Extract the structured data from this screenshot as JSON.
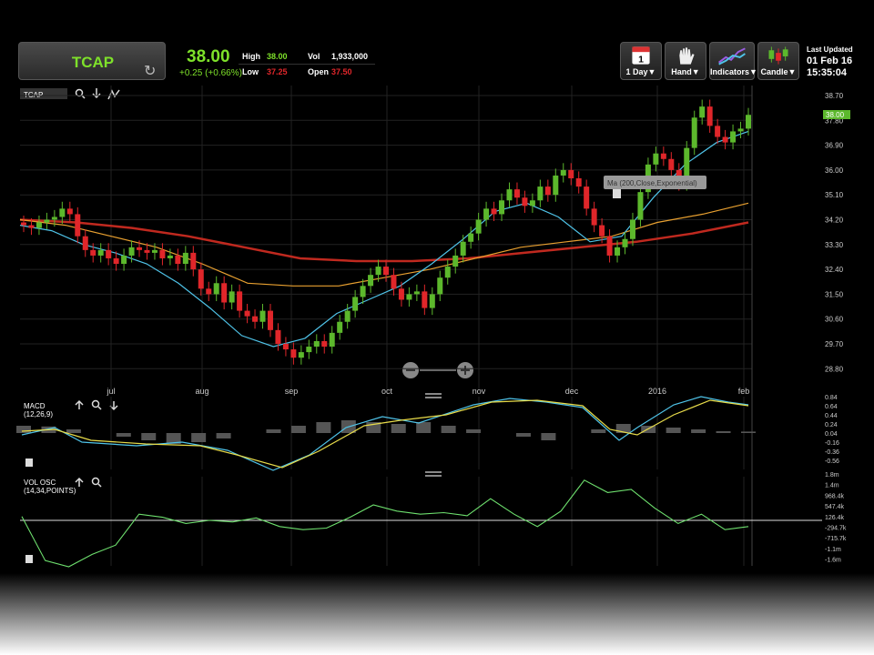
{
  "symbol": "TCAP",
  "quote": {
    "price": "38.00",
    "change": "+0.25 (+0.66%)",
    "high_label": "High",
    "high": "38.00",
    "low_label": "Low",
    "low": "37.25",
    "vol_label": "Vol",
    "vol": "1,933,000",
    "open_label": "Open",
    "open": "37.50"
  },
  "toolbar": {
    "period": "1 Day▼",
    "period_icon_text": "1",
    "hand": "Hand▼",
    "indicators": "Indicators▼",
    "candle": "Candle▼"
  },
  "updated": {
    "label": "Last Updated",
    "date": "01 Feb 16",
    "time": "15:35:04"
  },
  "colors": {
    "up": "#5cb82c",
    "down": "#e0262a",
    "accent": "#7ee12a",
    "grid": "#222222",
    "ma_fast": "#4fc3e8",
    "ma_slow": "#e8a030",
    "ma_long": "#c0291f",
    "signal": "#e8dc4a",
    "osc": "#6ee06e"
  },
  "price_chart": {
    "label": "TCAP",
    "y_ticks": [
      "38.70",
      "37.80",
      "36.90",
      "36.00",
      "35.10",
      "34.20",
      "33.30",
      "32.40",
      "31.50",
      "30.60",
      "29.70",
      "28.80"
    ],
    "x_ticks": [
      "jul",
      "aug",
      "sep",
      "oct",
      "nov",
      "dec",
      "2016",
      "feb"
    ],
    "last_tag": "38.00",
    "tooltip": "Ma (200,Close,Exponential)"
  },
  "macd": {
    "label1": "MACD",
    "label2": "(12,26,9)",
    "y_ticks": [
      "0.84",
      "0.64",
      "0.44",
      "0.24",
      "0.04",
      "-0.16",
      "-0.36",
      "-0.56"
    ]
  },
  "vol_osc": {
    "label1": "VOL OSC",
    "label2": "(14,34,POINTS)",
    "y_ticks": [
      "1.8m",
      "1.4m",
      "968.4k",
      "547.4k",
      "126.4k",
      "-294.7k",
      "-715.7k",
      "-1.1m",
      "-1.6m"
    ]
  },
  "chart_data": {
    "type": "candlestick",
    "ylim": [
      28.35,
      39.15
    ],
    "candles_close": [
      34.0,
      33.9,
      34.1,
      34.2,
      34.3,
      34.6,
      34.4,
      33.6,
      33.1,
      32.9,
      33.1,
      32.8,
      32.6,
      32.9,
      33.2,
      33.1,
      33.0,
      33.1,
      32.8,
      32.9,
      32.6,
      33.0,
      32.4,
      31.7,
      31.5,
      31.9,
      31.2,
      31.6,
      30.9,
      30.7,
      30.5,
      30.9,
      30.2,
      29.7,
      29.5,
      29.2,
      29.4,
      29.6,
      29.8,
      29.6,
      30.1,
      30.5,
      30.9,
      31.4,
      31.8,
      32.2,
      32.5,
      32.2,
      31.7,
      31.3,
      31.5,
      31.6,
      31.0,
      31.5,
      32.1,
      32.5,
      32.9,
      33.4,
      33.7,
      34.2,
      34.6,
      34.4,
      34.9,
      35.3,
      35.0,
      34.7,
      34.9,
      35.4,
      35.1,
      35.8,
      36.0,
      35.7,
      35.4,
      34.6,
      34.0,
      33.6,
      32.9,
      33.2,
      33.5,
      34.2,
      35.2,
      36.2,
      36.6,
      36.4,
      36.0,
      35.5,
      36.8,
      37.9,
      38.3,
      37.6,
      37.2,
      37.0,
      37.4,
      37.5,
      38.0
    ],
    "ma_fast": [
      34.0,
      33.8,
      33.3,
      33.0,
      32.6,
      31.9,
      31.0,
      30.0,
      29.6,
      29.9,
      30.8,
      31.3,
      31.8,
      32.6,
      33.5,
      34.5,
      34.8,
      34.3,
      33.4,
      33.6,
      35.0,
      36.2,
      37.0,
      37.4
    ],
    "ma_slow": [
      34.2,
      34.0,
      33.6,
      33.2,
      32.6,
      31.9,
      31.8,
      31.8,
      32.1,
      32.4,
      32.8,
      33.2,
      33.4,
      33.6,
      34.1,
      34.4,
      34.8
    ],
    "ma_long": [
      34.2,
      34.1,
      33.9,
      33.6,
      33.2,
      32.8,
      32.7,
      32.7,
      32.8,
      33.0,
      33.2,
      33.4,
      33.7,
      34.1
    ],
    "macd_hist": [
      0.2,
      0.18,
      0.1,
      0.0,
      -0.1,
      -0.2,
      -0.3,
      -0.25,
      -0.15,
      0.0,
      0.1,
      0.2,
      0.3,
      0.35,
      0.3,
      0.25,
      0.3,
      0.2,
      0.1,
      0.0,
      -0.1,
      -0.2,
      0.0,
      0.1,
      0.25,
      0.2,
      0.15,
      0.1,
      0.05,
      0.04
    ],
    "vol_osc": [
      126.4,
      -1300,
      -1500,
      -1100,
      -800,
      200,
      100,
      -100,
      0,
      -50,
      80,
      -200,
      -300,
      -250,
      100,
      500,
      300,
      200,
      250,
      150,
      700,
      200,
      -200,
      300,
      1300,
      900,
      1000,
      400,
      -100,
      200,
      -300,
      -200
    ]
  }
}
